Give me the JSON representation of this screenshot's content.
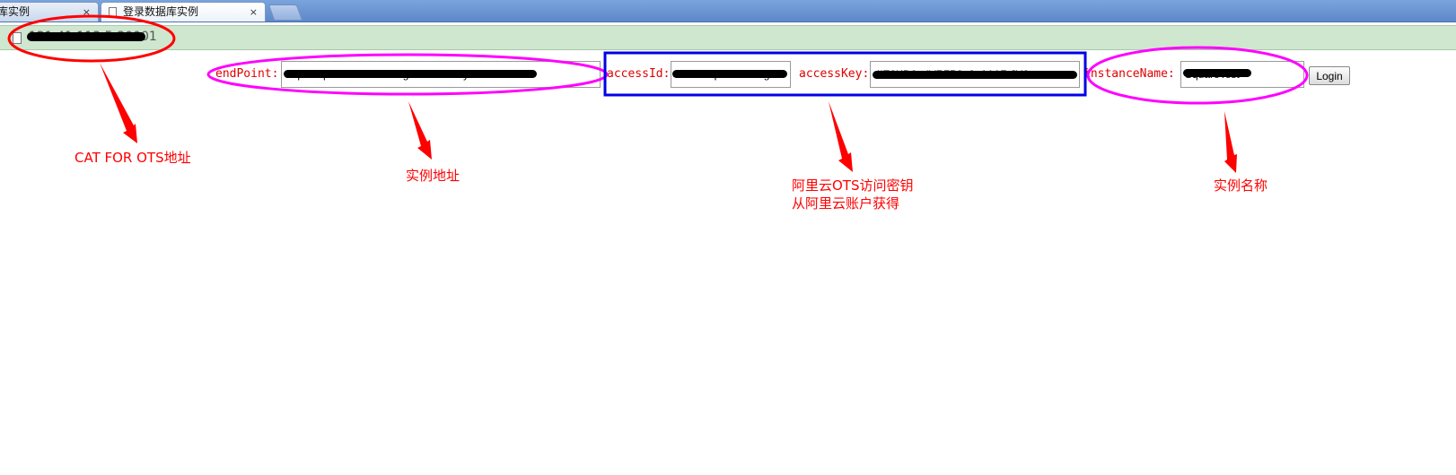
{
  "tabs": [
    {
      "label": "库实例",
      "close": "×"
    },
    {
      "label": "登录数据库实例",
      "close": "×"
    }
  ],
  "address": {
    "url": "121.41.113.5:30001"
  },
  "form": {
    "endpoint": {
      "label": "endPoint:",
      "value": "http://SquareTest.cn-hangzhou.ots.aliyuncs.com"
    },
    "access_id": {
      "label": "accessId:",
      "value": "LTAI4GqRGZRTs9go"
    },
    "access_key": {
      "label": "accessKey:",
      "value": "4lE2KD0udVR7P9e9sA1A7rJY6"
    },
    "instance": {
      "label": "instanceName:",
      "value": "SquareTest"
    },
    "login_label": "Login"
  },
  "annotations": {
    "cat_for_ots": "CAT FOR OTS地址",
    "instance_address": "实例地址",
    "access_key_line1": "阿里云OTS访问密钥",
    "access_key_line2": "从阿里云账户获得",
    "instance_name": "实例名称"
  },
  "colors": {
    "annotation_red": "#ff0000",
    "highlight_magenta": "#ff00ff",
    "highlight_blue": "#0000e6",
    "label_red": "#e00000",
    "address_bar_bg": "#cfe6cf"
  }
}
